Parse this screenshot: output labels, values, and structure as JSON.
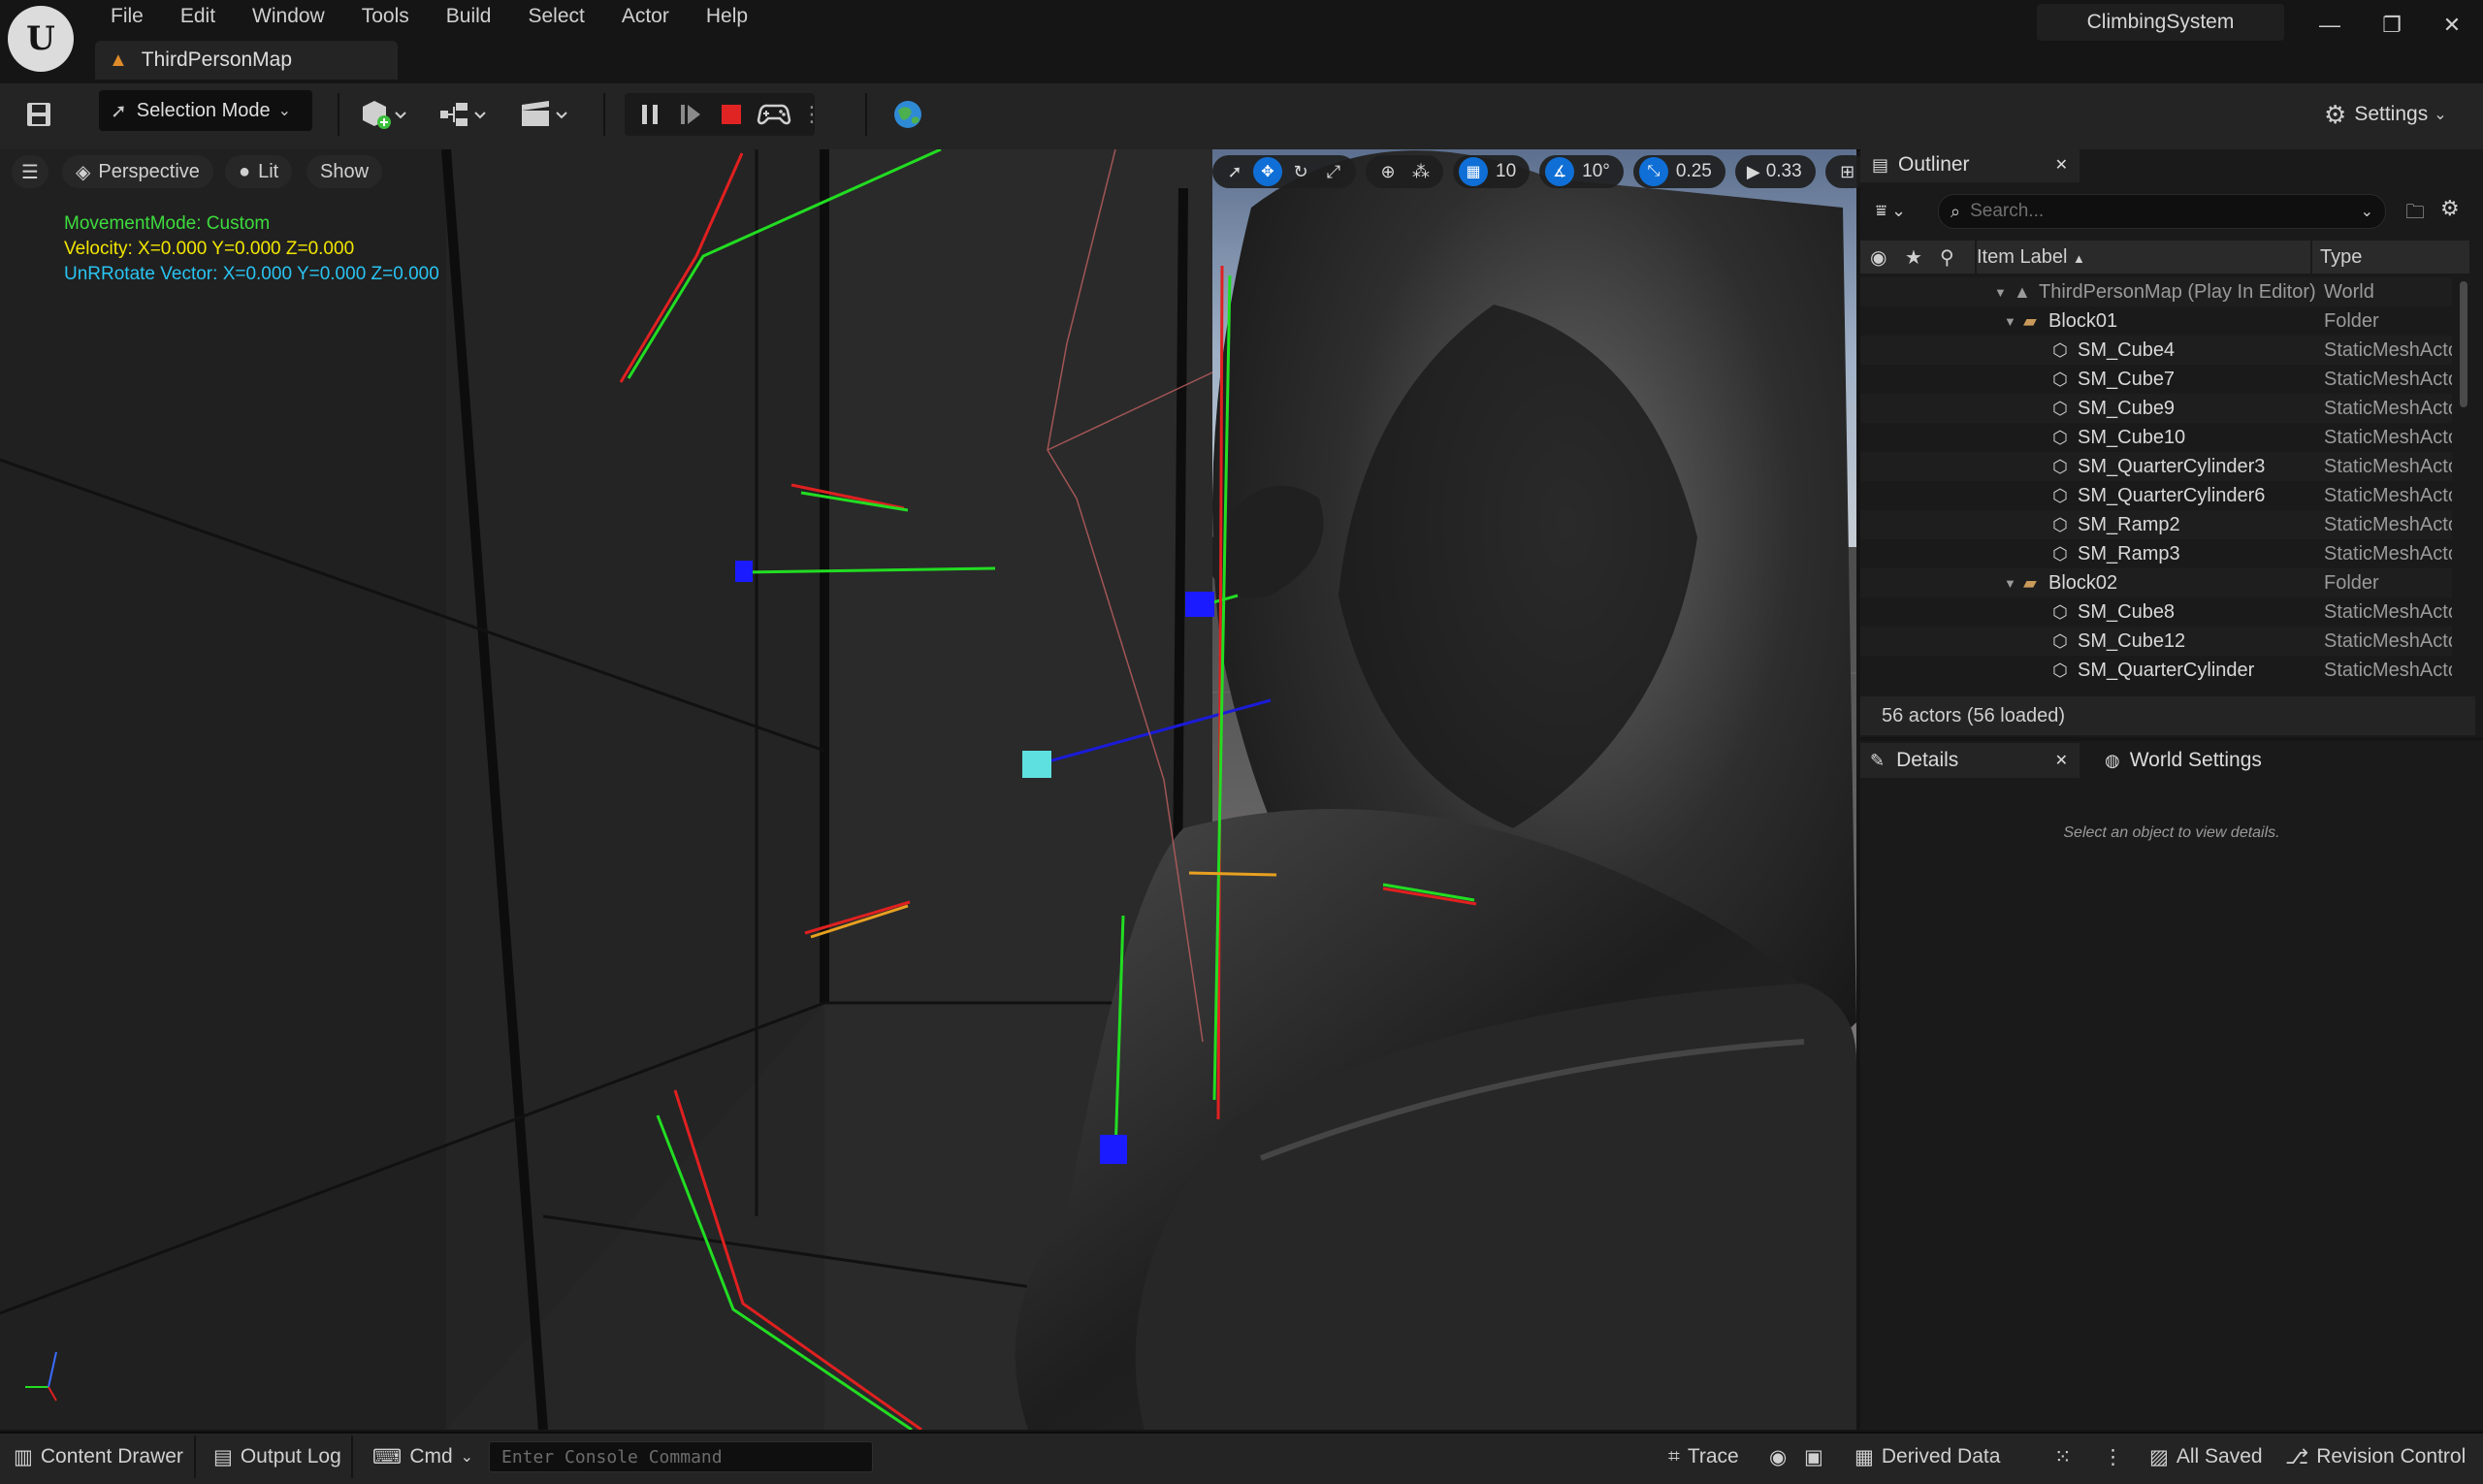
{
  "menu": [
    "File",
    "Edit",
    "Window",
    "Tools",
    "Build",
    "Select",
    "Actor",
    "Help"
  ],
  "tab": {
    "title": "ThirdPersonMap"
  },
  "project": "ClimbingSystem",
  "toolbar": {
    "selection_mode": "Selection Mode",
    "settings": "Settings"
  },
  "viewport": {
    "perspective": "Perspective",
    "lit": "Lit",
    "show": "Show",
    "grid_snap": "10",
    "rotation_snap": "10°",
    "scale_snap": "0.25",
    "camera_speed": "0.33",
    "debug": {
      "movement_mode": "MovementMode: Custom",
      "velocity": "Velocity: X=0.000 Y=0.000 Z=0.000",
      "unrotate": "UnRRotate Vector: X=0.000 Y=0.000 Z=0.000"
    }
  },
  "outliner": {
    "tab": "Outliner",
    "search_placeholder": "Search...",
    "col_label": "Item Label",
    "col_type": "Type",
    "rows": [
      {
        "label": "ThirdPersonMap (Play In Editor)",
        "type": "World",
        "kind": "world",
        "indent": 0
      },
      {
        "label": "Block01",
        "type": "Folder",
        "kind": "folder",
        "indent": 1
      },
      {
        "label": "SM_Cube4",
        "type": "StaticMeshActor",
        "kind": "mesh",
        "indent": 2
      },
      {
        "label": "SM_Cube7",
        "type": "StaticMeshActor",
        "kind": "mesh",
        "indent": 2
      },
      {
        "label": "SM_Cube9",
        "type": "StaticMeshActor",
        "kind": "mesh",
        "indent": 2
      },
      {
        "label": "SM_Cube10",
        "type": "StaticMeshActor",
        "kind": "mesh",
        "indent": 2
      },
      {
        "label": "SM_QuarterCylinder3",
        "type": "StaticMeshActor",
        "kind": "mesh",
        "indent": 2
      },
      {
        "label": "SM_QuarterCylinder6",
        "type": "StaticMeshActor",
        "kind": "mesh",
        "indent": 2
      },
      {
        "label": "SM_Ramp2",
        "type": "StaticMeshActor",
        "kind": "mesh",
        "indent": 2
      },
      {
        "label": "SM_Ramp3",
        "type": "StaticMeshActor",
        "kind": "mesh",
        "indent": 2
      },
      {
        "label": "Block02",
        "type": "Folder",
        "kind": "folder",
        "indent": 1
      },
      {
        "label": "SM_Cube8",
        "type": "StaticMeshActor",
        "kind": "mesh",
        "indent": 2
      },
      {
        "label": "SM_Cube12",
        "type": "StaticMeshActor",
        "kind": "mesh",
        "indent": 2
      },
      {
        "label": "SM_QuarterCylinder",
        "type": "StaticMeshActor",
        "kind": "mesh",
        "indent": 2
      }
    ],
    "status": "56 actors (56 loaded)"
  },
  "details": {
    "tab": "Details",
    "world_settings_tab": "World Settings",
    "empty": "Select an object to view details."
  },
  "statusbar": {
    "content_drawer": "Content Drawer",
    "output_log": "Output Log",
    "cmd": "Cmd",
    "console_placeholder": "Enter Console Command",
    "trace": "Trace",
    "derived_data": "Derived Data",
    "all_saved": "All Saved",
    "revision_control": "Revision Control"
  },
  "colors": {
    "accent": "#0f6fd6",
    "debug_green": "#3ddc3d",
    "debug_yellow": "#f2e600",
    "debug_cyan": "#29c4f2",
    "folder": "#c99a5a",
    "stop_red": "#e02424"
  }
}
